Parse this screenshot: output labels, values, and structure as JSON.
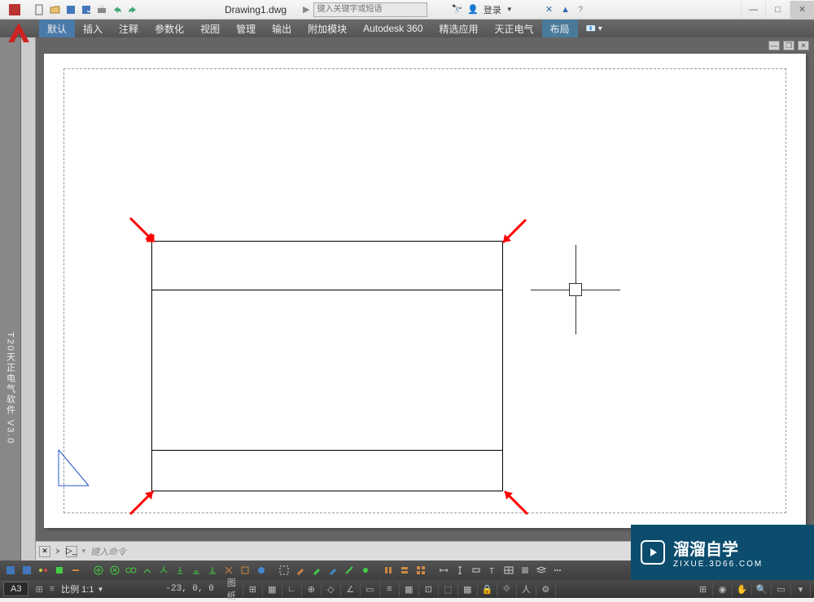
{
  "titlebar": {
    "document_name": "Drawing1.dwg",
    "search_placeholder": "键入关键字或短语",
    "login_label": "登录"
  },
  "menubar": {
    "items": [
      {
        "label": "默认"
      },
      {
        "label": "插入"
      },
      {
        "label": "注释"
      },
      {
        "label": "参数化"
      },
      {
        "label": "视图"
      },
      {
        "label": "管理"
      },
      {
        "label": "输出"
      },
      {
        "label": "附加模块"
      },
      {
        "label": "Autodesk 360"
      },
      {
        "label": "精选应用"
      },
      {
        "label": "天正电气"
      },
      {
        "label": "布局"
      }
    ],
    "active_index": 11
  },
  "sidebar": {
    "vertical_tab_label": "T20天正电气软件 V3.0"
  },
  "commandline": {
    "placeholder": "键入命令"
  },
  "statusbar": {
    "layout_tab": "A3",
    "scale_label": "比例 1:1",
    "coordinates": "-23, 0, 0",
    "paper_label": "图纸"
  },
  "watermark": {
    "title": "溜溜自学",
    "url": "ZIXUE.3D66.COM"
  }
}
